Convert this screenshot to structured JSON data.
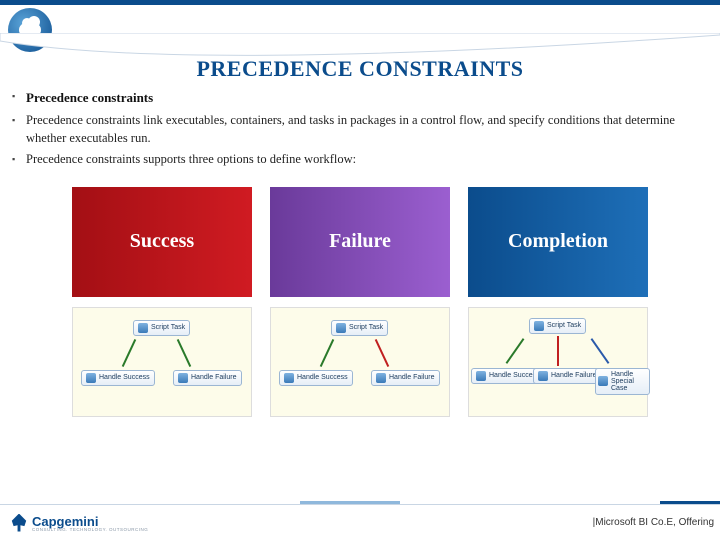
{
  "title": "PRECEDENCE CONSTRAINTS",
  "bullets": {
    "heading": "Precedence constraints",
    "p1": "Precedence constraints link executables, containers, and tasks in packages in a control flow, and specify conditions that determine whether executables run.",
    "p2": "Precedence constraints supports three options to define workflow:"
  },
  "boxes": {
    "a": "Success",
    "b": "Failure",
    "c": "Completion"
  },
  "tasks": {
    "script": "Script Task",
    "hsuccess": "Handle Success",
    "hfailure": "Handle Failure",
    "hspecial": "Handle Special Case"
  },
  "footer": {
    "brand": "Capgemini",
    "tag": "CONSULTING. TECHNOLOGY. OUTSOURCING",
    "right": "|Microsoft BI Co.E, Offering"
  }
}
